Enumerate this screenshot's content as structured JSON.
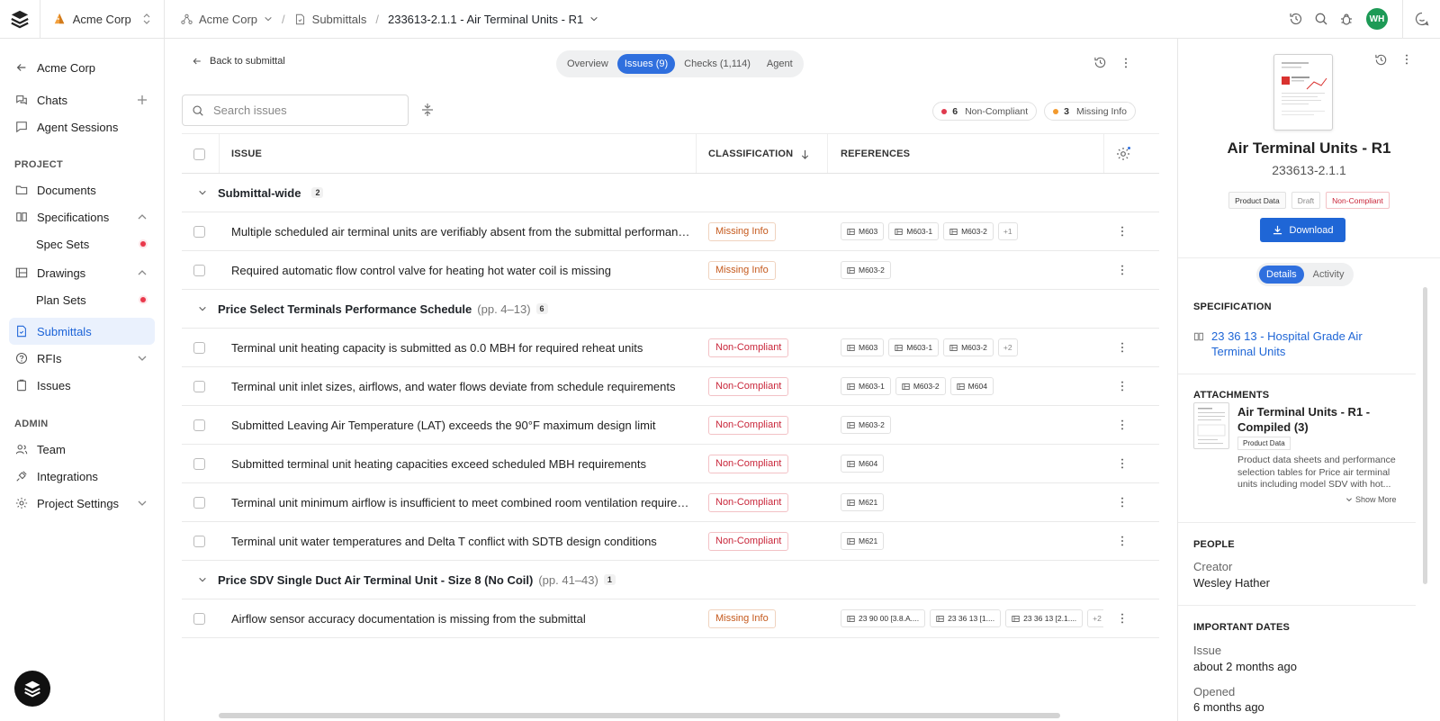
{
  "org": {
    "name": "Acme Corp"
  },
  "breadcrumb": {
    "org": "Acme Corp",
    "section": "Submittals",
    "current": "233613-2.1.1 - Air Terminal Units - R1"
  },
  "user": {
    "initials": "WH"
  },
  "sidebar": {
    "back_label": "Acme Corp",
    "items": {
      "chats": "Chats",
      "agent_sessions": "Agent Sessions",
      "project_heading": "PROJECT",
      "documents": "Documents",
      "specifications": "Specifications",
      "spec_sets": "Spec Sets",
      "drawings": "Drawings",
      "plan_sets": "Plan Sets",
      "submittals": "Submittals",
      "rfis": "RFIs",
      "issues": "Issues",
      "admin_heading": "ADMIN",
      "team": "Team",
      "integrations": "Integrations",
      "project_settings": "Project Settings"
    }
  },
  "main": {
    "back_label": "Back to submittal",
    "tabs": {
      "overview": "Overview",
      "issues": "Issues (9)",
      "checks": "Checks (1,114)",
      "agent": "Agent"
    },
    "search": {
      "placeholder": "Search issues"
    },
    "summary": {
      "noncompliant_count": "6",
      "noncompliant_label": "Non-Compliant",
      "missing_count": "3",
      "missing_label": "Missing Info"
    },
    "columns": {
      "issue": "ISSUE",
      "classification": "CLASSIFICATION",
      "references": "REFERENCES"
    },
    "groups": [
      {
        "title": "Submittal-wide",
        "pages": "",
        "count": "2",
        "rows": [
          {
            "text": "Multiple scheduled air terminal units are verifiably absent from the submittal performance s...",
            "classification": "Missing Info",
            "refs": [
              "M603",
              "M603-1",
              "M603-2"
            ],
            "more": "+1"
          },
          {
            "text": "Required automatic flow control valve for heating hot water coil is missing",
            "classification": "Missing Info",
            "refs": [
              "M603-2"
            ],
            "more": ""
          }
        ]
      },
      {
        "title": "Price Select Terminals Performance Schedule",
        "pages": "(pp. 4–13)",
        "count": "6",
        "rows": [
          {
            "text": "Terminal unit heating capacity is submitted as 0.0 MBH for required reheat units",
            "classification": "Non-Compliant",
            "refs": [
              "M603",
              "M603-1",
              "M603-2"
            ],
            "more": "+2"
          },
          {
            "text": "Terminal unit inlet sizes, airflows, and water flows deviate from schedule requirements",
            "classification": "Non-Compliant",
            "refs": [
              "M603-1",
              "M603-2",
              "M604"
            ],
            "more": ""
          },
          {
            "text": "Submitted Leaving Air Temperature (LAT) exceeds the 90°F maximum design limit",
            "classification": "Non-Compliant",
            "refs": [
              "M603-2"
            ],
            "more": ""
          },
          {
            "text": "Submitted terminal unit heating capacities exceed scheduled MBH requirements",
            "classification": "Non-Compliant",
            "refs": [
              "M604"
            ],
            "more": ""
          },
          {
            "text": "Terminal unit minimum airflow is insufficient to meet combined room ventilation requirements",
            "classification": "Non-Compliant",
            "refs": [
              "M621"
            ],
            "more": ""
          },
          {
            "text": "Terminal unit water temperatures and Delta T conflict with SDTB design conditions",
            "classification": "Non-Compliant",
            "refs": [
              "M621"
            ],
            "more": ""
          }
        ]
      },
      {
        "title": "Price SDV Single Duct Air Terminal Unit - Size 8 (No Coil)",
        "pages": "(pp. 41–43)",
        "count": "1",
        "rows": [
          {
            "text": "Airflow sensor accuracy documentation is missing from the submittal",
            "classification": "Missing Info",
            "refs": [
              "23 90 00 [3.8.A....",
              "23 36 13 [1....",
              "23 36 13 [2.1...."
            ],
            "more": "+2"
          }
        ]
      }
    ]
  },
  "panel": {
    "title": "Air Terminal Units - R1",
    "subtitle": "233613-2.1.1",
    "badges": {
      "type": "Product Data",
      "status": "Draft",
      "compliance": "Non-Compliant"
    },
    "download_label": "Download",
    "tabs": {
      "details": "Details",
      "activity": "Activity"
    },
    "specification": {
      "heading": "SPECIFICATION",
      "link": "23 36 13 - Hospital Grade Air Terminal Units"
    },
    "attachments": {
      "heading": "ATTACHMENTS",
      "title": "Air Terminal Units - R1 - Compiled (3)",
      "tag": "Product Data",
      "description": "Product data sheets and performance selection tables for Price air terminal units including model SDV with hot...",
      "show_more": "Show More"
    },
    "people": {
      "heading": "PEOPLE",
      "creator_label": "Creator",
      "creator": "Wesley Hather"
    },
    "dates": {
      "heading": "IMPORTANT DATES",
      "issue_label": "Issue",
      "issue": "about 2 months ago",
      "opened_label": "Opened",
      "opened": "6 months ago"
    }
  },
  "colors": {
    "accent": "#2f6fde",
    "noncompliant": "#c9263a",
    "missing": "#c5591c",
    "avatar": "#1d9a56"
  }
}
